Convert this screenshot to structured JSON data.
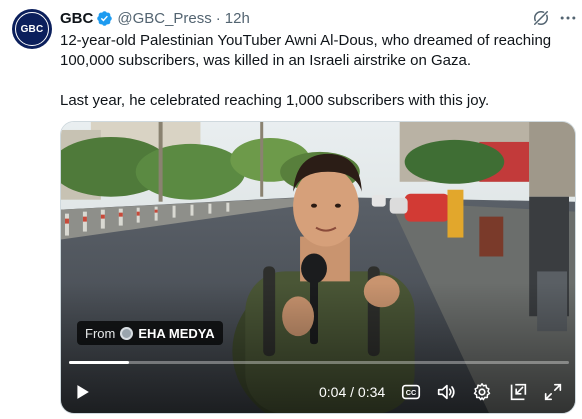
{
  "account": {
    "avatar_text": "GBC",
    "name": "GBC",
    "handle": "@GBC_Press",
    "separator": "·",
    "time": "12h"
  },
  "tweet": {
    "paragraph1": "12-year-old Palestinian YouTuber Awni Al-Dous, who dreamed of reaching 100,000 subscribers, was killed in an Israeli airstrike on Gaza.",
    "paragraph2": "Last year, he celebrated reaching 1,000 subscribers with this joy."
  },
  "video": {
    "source_prefix": "From",
    "source_name": "EHA MEDYA",
    "current_time": "0:04",
    "duration": "0:34",
    "time_separator": "/",
    "progress_fraction": 0.12
  },
  "icons": {
    "verified": "verified-badge-icon",
    "grok": "grok-icon",
    "more": "more-icon",
    "play": "play-icon",
    "captions": "captions-icon",
    "volume": "volume-icon",
    "settings": "gear-icon",
    "pip": "picture-in-picture-icon",
    "fullscreen": "fullscreen-icon"
  },
  "colors": {
    "verified_blue": "#1d9bf0",
    "avatar_bg": "#0b1f5c",
    "secondary_text": "#536471"
  }
}
